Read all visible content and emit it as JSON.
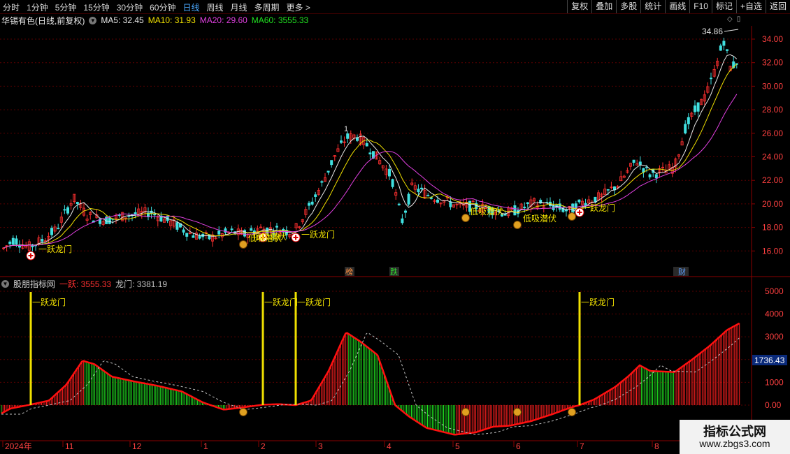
{
  "toolbar": {
    "periods": [
      "分时",
      "1分钟",
      "5分钟",
      "15分钟",
      "30分钟",
      "60分钟",
      "日线",
      "周线",
      "月线",
      "多周期",
      "更多 >"
    ],
    "active_period": "日线",
    "actions": [
      "复权",
      "叠加",
      "多股",
      "统计",
      "画线",
      "F10",
      "标记",
      "+自选",
      "返回"
    ]
  },
  "stock": {
    "title": "华锡有色(日线,前复权)",
    "ma5": "MA5: 32.45",
    "ma10": "MA10: 31.93",
    "ma20": "MA20: 29.60",
    "ma60": "MA60: 3555.33"
  },
  "main_chart": {
    "y_ticks": [
      "34.00",
      "32.00",
      "30.00",
      "28.00",
      "26.00",
      "24.00",
      "22.00",
      "20.00",
      "18.00",
      "16.00"
    ],
    "high_label": "34.86",
    "low_label": "1",
    "markers": [
      "一跃龙门",
      "低吸潜伏",
      "一跃龙门",
      "一跃龙门",
      "低吸潜伏",
      "低吸潜伏",
      "一跃龙门"
    ],
    "event_tags": [
      "榜",
      "跌",
      "财"
    ],
    "colors": {
      "up": "#ff3030",
      "down": "#40e0e0",
      "ma5": "#e8e8e8",
      "ma10": "#f0e000",
      "ma20": "#e040e0"
    }
  },
  "indicator": {
    "name": "股朋指标网",
    "a_label": "一跃: 3555.33",
    "b_label": "龙门: 3381.19",
    "y_ticks": [
      "5000",
      "4000",
      "3000",
      "2000",
      "1000",
      "0.00"
    ],
    "current_value": "1736.43",
    "signal_label": "一跃龙门"
  },
  "x_axis": {
    "labels": [
      "2024年",
      "11",
      "12",
      "1",
      "2",
      "3",
      "4",
      "5",
      "6",
      "7",
      "8"
    ]
  },
  "watermark": {
    "line1": "指标公式网",
    "line2": "www.zbgs3.com"
  }
}
